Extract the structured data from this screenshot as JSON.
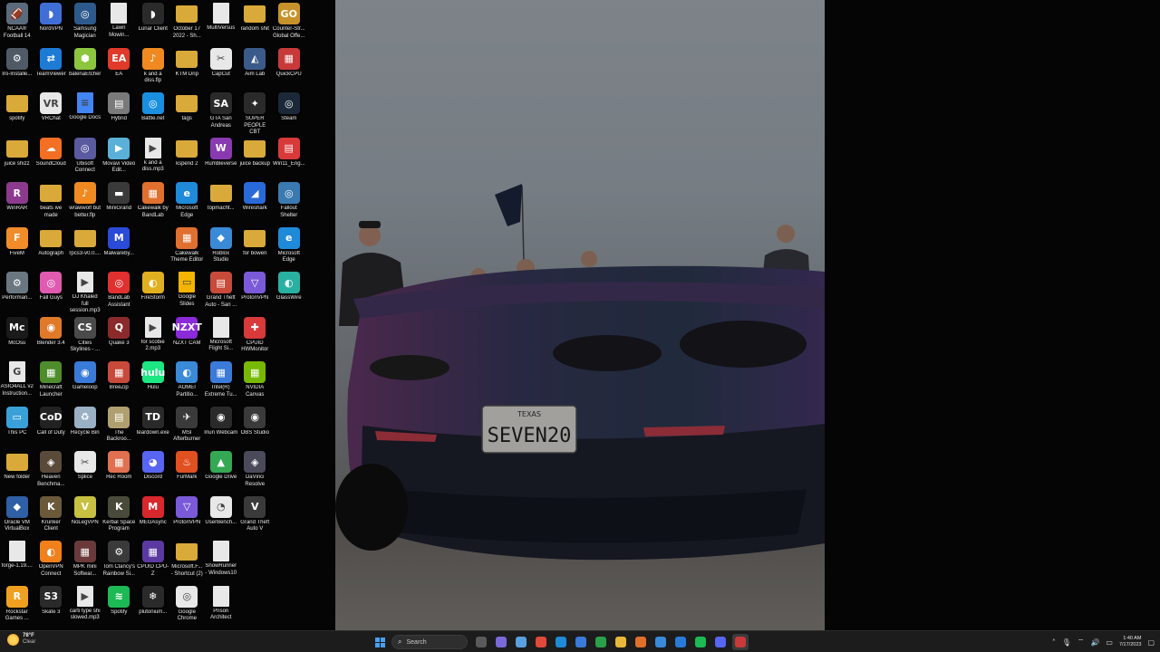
{
  "desktop": {
    "icons": [
      {
        "label": "NCAA® Football 14",
        "color": "#5a6b7c",
        "glyph": "🏈",
        "kind": "app"
      },
      {
        "label": "Iro-Installe...",
        "color": "#4f5a66",
        "glyph": "⚙",
        "kind": "app"
      },
      {
        "label": "spotify",
        "color": "#d9a93a",
        "glyph": "",
        "kind": "folder"
      },
      {
        "label": "juice shizz",
        "color": "#d9a93a",
        "glyph": "",
        "kind": "folder"
      },
      {
        "label": "WinRAR",
        "color": "#8b3a8e",
        "glyph": "R",
        "kind": "app"
      },
      {
        "label": "FiveM",
        "color": "#f08c2a",
        "glyph": "F",
        "kind": "app"
      },
      {
        "label": "Performan...",
        "color": "#6b7780",
        "glyph": "⚙",
        "kind": "app"
      },
      {
        "label": "McOsu",
        "color": "#1a1a1a",
        "glyph": "Mc",
        "kind": "app"
      },
      {
        "label": "ASIO4ALL v2 Instruction...",
        "color": "#e8e8e8",
        "glyph": "G",
        "kind": "doc"
      },
      {
        "label": "This PC",
        "color": "#3aa0d8",
        "glyph": "▭",
        "kind": "app"
      },
      {
        "label": "New folder",
        "color": "#d9a93a",
        "glyph": "",
        "kind": "folder"
      },
      {
        "label": "Oracle VM VirtualBox",
        "color": "#2f5fa5",
        "glyph": "◆",
        "kind": "app"
      },
      {
        "label": "forge-1.19....",
        "color": "#e8e8e8",
        "glyph": "",
        "kind": "doc"
      },
      {
        "label": "Rockstar Games ...",
        "color": "#f0a020",
        "glyph": "R",
        "kind": "app"
      },
      {
        "label": "NordVPN",
        "color": "#3f6fd6",
        "glyph": "◗",
        "kind": "app"
      },
      {
        "label": "TeamViewer",
        "color": "#1d7bd6",
        "glyph": "⇄",
        "kind": "app"
      },
      {
        "label": "VRChat",
        "color": "#e8e8e8",
        "glyph": "VR",
        "kind": "app"
      },
      {
        "label": "SoundCloud",
        "color": "#f26f23",
        "glyph": "☁",
        "kind": "app"
      },
      {
        "label": "beats ive made",
        "color": "#d9a93a",
        "glyph": "",
        "kind": "folder"
      },
      {
        "label": "Autograph",
        "color": "#d9a93a",
        "glyph": "",
        "kind": "folder"
      },
      {
        "label": "Fall Guys",
        "color": "#e05ab0",
        "glyph": "◎",
        "kind": "app"
      },
      {
        "label": "Blender 3.4",
        "color": "#e07a2a",
        "glyph": "◉",
        "kind": "app"
      },
      {
        "label": "Minecraft Launcher",
        "color": "#4e8c2c",
        "glyph": "▦",
        "kind": "app"
      },
      {
        "label": "Call of Duty",
        "color": "#222222",
        "glyph": "CoD",
        "kind": "app"
      },
      {
        "label": "Heaven Benchma...",
        "color": "#5a4a3a",
        "glyph": "◈",
        "kind": "app"
      },
      {
        "label": "Krunker Client",
        "color": "#6a5a3a",
        "glyph": "K",
        "kind": "app"
      },
      {
        "label": "OpenVPN Connect",
        "color": "#f0801c",
        "glyph": "◐",
        "kind": "app"
      },
      {
        "label": "Skate 3",
        "color": "#2a2a2a",
        "glyph": "S3",
        "kind": "app"
      },
      {
        "label": "Samsung Magician",
        "color": "#2d5a8c",
        "glyph": "◎",
        "kind": "app"
      },
      {
        "label": "balenaEtcher",
        "color": "#8cc63f",
        "glyph": "⬢",
        "kind": "app"
      },
      {
        "label": "Google Docs",
        "color": "#4285f4",
        "glyph": "≡",
        "kind": "doc"
      },
      {
        "label": "Ubisoft Connect",
        "color": "#5a5aa0",
        "glyph": "◎",
        "kind": "app"
      },
      {
        "label": "wrawwolf but better.flp",
        "color": "#f08a20",
        "glyph": "♪",
        "kind": "app"
      },
      {
        "label": "rpcs3-v0.0....",
        "color": "#d9a93a",
        "glyph": "",
        "kind": "folder"
      },
      {
        "label": "DJ Khaled full session.mp3",
        "color": "#e8e8e8",
        "glyph": "▶",
        "kind": "doc"
      },
      {
        "label": "Cities Skylines - ...",
        "color": "#4a4a4a",
        "glyph": "CS",
        "kind": "app"
      },
      {
        "label": "Gameloop",
        "color": "#3a7ad8",
        "glyph": "◉",
        "kind": "app"
      },
      {
        "label": "Recycle Bin",
        "color": "#9ab0c4",
        "glyph": "♻",
        "kind": "app"
      },
      {
        "label": "Splice",
        "color": "#e8e8e8",
        "glyph": "✂",
        "kind": "app"
      },
      {
        "label": "NoLegVPN",
        "color": "#c8c040",
        "glyph": "V",
        "kind": "app"
      },
      {
        "label": "MPK mini Softwar...",
        "color": "#6a3a3a",
        "glyph": "▦",
        "kind": "app"
      },
      {
        "label": "carti type shi slowed.mp3",
        "color": "#e8e8e8",
        "glyph": "▶",
        "kind": "doc"
      },
      {
        "label": "Lawn Mowin...",
        "color": "#e8e8e8",
        "glyph": "",
        "kind": "doc"
      },
      {
        "label": "EA",
        "color": "#e03a2a",
        "glyph": "EA",
        "kind": "app"
      },
      {
        "label": "Hybrid",
        "color": "#7a7a7a",
        "glyph": "▤",
        "kind": "app"
      },
      {
        "label": "Movavi Video Edit...",
        "color": "#5ab0d8",
        "glyph": "▶",
        "kind": "app"
      },
      {
        "label": "MiniGrand",
        "color": "#3a3a3a",
        "glyph": "▬",
        "kind": "app"
      },
      {
        "label": "Malwareby...",
        "color": "#2a4ad8",
        "glyph": "M",
        "kind": "app"
      },
      {
        "label": "BandLab Assistant",
        "color": "#e03030",
        "glyph": "◎",
        "kind": "app"
      },
      {
        "label": "Quake 3",
        "color": "#8a2a2a",
        "glyph": "Q",
        "kind": "app"
      },
      {
        "label": "BreeZip",
        "color": "#c84a3a",
        "glyph": "▦",
        "kind": "app"
      },
      {
        "label": "The Backroo...",
        "color": "#b0a070",
        "glyph": "▤",
        "kind": "app"
      },
      {
        "label": "Rec Room",
        "color": "#e07050",
        "glyph": "▦",
        "kind": "app"
      },
      {
        "label": "Kerbal Space Program",
        "color": "#4a4a3a",
        "glyph": "K",
        "kind": "app"
      },
      {
        "label": "Tom Clancy's Rainbow Si...",
        "color": "#3a3a3a",
        "glyph": "⚙",
        "kind": "app"
      },
      {
        "label": "Spotify",
        "color": "#1db954",
        "glyph": "≋",
        "kind": "app"
      },
      {
        "label": "Lunar Client",
        "color": "#2a2a2a",
        "glyph": "◗",
        "kind": "app"
      },
      {
        "label": "k and a diss.flp",
        "color": "#f08a20",
        "glyph": "♪",
        "kind": "app"
      },
      {
        "label": "Battle.net",
        "color": "#1a8fe0",
        "glyph": "◎",
        "kind": "app"
      },
      {
        "label": "k and a diss.mp3",
        "color": "#e8e8e8",
        "glyph": "▶",
        "kind": "doc"
      },
      {
        "label": "Cakewalk by BandLab",
        "color": "#e07030",
        "glyph": "▦",
        "kind": "app"
      },
      {
        "label": "",
        "color": "#000000",
        "glyph": "",
        "kind": "empty"
      },
      {
        "label": "FireStorm",
        "color": "#e0b020",
        "glyph": "◐",
        "kind": "app"
      },
      {
        "label": "for scobie 2.mp3",
        "color": "#e8e8e8",
        "glyph": "▶",
        "kind": "doc"
      },
      {
        "label": "Hulu",
        "color": "#1ce783",
        "glyph": "hulu",
        "kind": "app"
      },
      {
        "label": "teardown.exe",
        "color": "#2a2a2a",
        "glyph": "TD",
        "kind": "app"
      },
      {
        "label": "Discord",
        "color": "#5865f2",
        "glyph": "◕",
        "kind": "app"
      },
      {
        "label": "MEGAsync",
        "color": "#d9272e",
        "glyph": "M",
        "kind": "app"
      },
      {
        "label": "CPUID CPU-Z",
        "color": "#5a3aa0",
        "glyph": "▦",
        "kind": "app"
      },
      {
        "label": "plutonium...",
        "color": "#2a2a2a",
        "glyph": "❄",
        "kind": "app"
      },
      {
        "label": "October 17 2022 - Sh...",
        "color": "#d9a93a",
        "glyph": "",
        "kind": "folder"
      },
      {
        "label": "KTM Drip",
        "color": "#d9a93a",
        "glyph": "",
        "kind": "folder"
      },
      {
        "label": "tags",
        "color": "#d9a93a",
        "glyph": "",
        "kind": "folder"
      },
      {
        "label": "kspend 2",
        "color": "#d9a93a",
        "glyph": "",
        "kind": "folder"
      },
      {
        "label": "Microsoft Edge",
        "color": "#1f8ad8",
        "glyph": "e",
        "kind": "app"
      },
      {
        "label": "Cakewalk Theme Editor",
        "color": "#e07030",
        "glyph": "▦",
        "kind": "app"
      },
      {
        "label": "Google Slides",
        "color": "#f4b400",
        "glyph": "▭",
        "kind": "doc"
      },
      {
        "label": "NZXT CAM",
        "color": "#8a2ad8",
        "glyph": "NZXT",
        "kind": "app"
      },
      {
        "label": "AOMEI Partitio...",
        "color": "#3a8ad8",
        "glyph": "◐",
        "kind": "app"
      },
      {
        "label": "MSI Afterburner",
        "color": "#3a3a3a",
        "glyph": "✈",
        "kind": "app"
      },
      {
        "label": "FurMark",
        "color": "#e05020",
        "glyph": "♨",
        "kind": "app"
      },
      {
        "label": "ProtonVPN",
        "color": "#7a5ad8",
        "glyph": "▽",
        "kind": "app"
      },
      {
        "label": "Microsoft.F... - Shortcut (2)",
        "color": "#d9a93a",
        "glyph": "",
        "kind": "folder"
      },
      {
        "label": "Google Chrome",
        "color": "#e8e8e8",
        "glyph": "◎",
        "kind": "app"
      },
      {
        "label": "MultiVersus",
        "color": "#e8e8e8",
        "glyph": "",
        "kind": "doc"
      },
      {
        "label": "CapCut",
        "color": "#e8e8e8",
        "glyph": "✂",
        "kind": "app"
      },
      {
        "label": "GTA San Andreas",
        "color": "#2a2a2a",
        "glyph": "SA",
        "kind": "app"
      },
      {
        "label": "Rumbleverse",
        "color": "#8a3ab0",
        "glyph": "W",
        "kind": "app"
      },
      {
        "label": "topmacht...",
        "color": "#d9a93a",
        "glyph": "",
        "kind": "folder"
      },
      {
        "label": "Roblox Studio",
        "color": "#3a8ad8",
        "glyph": "◆",
        "kind": "app"
      },
      {
        "label": "Grand Theft Auto - San ...",
        "color": "#c84a3a",
        "glyph": "▤",
        "kind": "app"
      },
      {
        "label": "Microsoft Flight Si...",
        "color": "#e8e8e8",
        "glyph": "",
        "kind": "doc"
      },
      {
        "label": "Intel(R) Extreme Tu...",
        "color": "#3a7ad8",
        "glyph": "▦",
        "kind": "app"
      },
      {
        "label": "Iriun Webcam",
        "color": "#2a2a2a",
        "glyph": "◉",
        "kind": "app"
      },
      {
        "label": "Google Drive",
        "color": "#34a853",
        "glyph": "▲",
        "kind": "app"
      },
      {
        "label": "UserBench...",
        "color": "#e8e8e8",
        "glyph": "◔",
        "kind": "app"
      },
      {
        "label": "SnowRunner - Windows10",
        "color": "#e8e8e8",
        "glyph": "",
        "kind": "doc"
      },
      {
        "label": "Prison Architect",
        "color": "#e8e8e8",
        "glyph": "",
        "kind": "doc"
      },
      {
        "label": "random shit",
        "color": "#d9a93a",
        "glyph": "",
        "kind": "folder"
      },
      {
        "label": "Aim Lab",
        "color": "#3a5a8a",
        "glyph": "◭",
        "kind": "app"
      },
      {
        "label": "SUPER PEOPLE CBT",
        "color": "#2a2a2a",
        "glyph": "✦",
        "kind": "app"
      },
      {
        "label": "juice backup",
        "color": "#d9a93a",
        "glyph": "",
        "kind": "folder"
      },
      {
        "label": "Wireshark",
        "color": "#2a6ad8",
        "glyph": "◢",
        "kind": "app"
      },
      {
        "label": "for bowen",
        "color": "#d9a93a",
        "glyph": "",
        "kind": "folder"
      },
      {
        "label": "ProtonVPN",
        "color": "#7a5ad8",
        "glyph": "▽",
        "kind": "app"
      },
      {
        "label": "CPUID HWMonitor",
        "color": "#d83a3a",
        "glyph": "✚",
        "kind": "app"
      },
      {
        "label": "NVIDIA Canvas",
        "color": "#76b900",
        "glyph": "▦",
        "kind": "app"
      },
      {
        "label": "OBS Studio",
        "color": "#3a3a3a",
        "glyph": "◉",
        "kind": "app"
      },
      {
        "label": "DaVinci Resolve",
        "color": "#4a4a5a",
        "glyph": "◈",
        "kind": "app"
      },
      {
        "label": "Grand Theft Auto V",
        "color": "#3a3a3a",
        "glyph": "V",
        "kind": "app"
      },
      {
        "label": "",
        "color": "#000000",
        "glyph": "",
        "kind": "empty"
      },
      {
        "label": "",
        "color": "#000000",
        "glyph": "",
        "kind": "empty"
      },
      {
        "label": "Counter-Str... Global Offe...",
        "color": "#c8922a",
        "glyph": "GO",
        "kind": "app"
      },
      {
        "label": "QuickCPU",
        "color": "#c83a3a",
        "glyph": "▦",
        "kind": "app"
      },
      {
        "label": "Steam",
        "color": "#1b2838",
        "glyph": "◎",
        "kind": "app"
      },
      {
        "label": "Win11_Eng...",
        "color": "#d83a3a",
        "glyph": "▤",
        "kind": "app"
      },
      {
        "label": "Fallout Shelter",
        "color": "#3a7ab0",
        "glyph": "◎",
        "kind": "app"
      },
      {
        "label": "Microsoft Edge",
        "color": "#1f8ad8",
        "glyph": "e",
        "kind": "app"
      },
      {
        "label": "GlassWire",
        "color": "#2ab0a0",
        "glyph": "◐",
        "kind": "app"
      }
    ]
  },
  "taskbar": {
    "weather_temp": "78°F",
    "weather_cond": "Clear",
    "search_placeholder": "Search",
    "clock_time": "1:40 AM",
    "clock_date": "7/17/2023",
    "apps": [
      {
        "name": "task-view",
        "color": "#5a5a5a"
      },
      {
        "name": "teams",
        "color": "#7a6ad8"
      },
      {
        "name": "copilot",
        "color": "#5aa0e0"
      },
      {
        "name": "chrome",
        "color": "#e04a3a"
      },
      {
        "name": "edge",
        "color": "#1f8ad8"
      },
      {
        "name": "store",
        "color": "#3a7ad8"
      },
      {
        "name": "xbox",
        "color": "#2aa04a"
      },
      {
        "name": "file-explorer",
        "color": "#e8b83a"
      },
      {
        "name": "firefox",
        "color": "#e0702a"
      },
      {
        "name": "photos",
        "color": "#3a8ad8"
      },
      {
        "name": "vscode",
        "color": "#2a7ad8"
      },
      {
        "name": "spotify",
        "color": "#1db954"
      },
      {
        "name": "discord",
        "color": "#5865f2"
      },
      {
        "name": "recorder",
        "color": "#c83a3a"
      }
    ]
  },
  "wallpaper": {
    "plate_state": "TEXAS",
    "plate_text": "SEVEN20"
  }
}
